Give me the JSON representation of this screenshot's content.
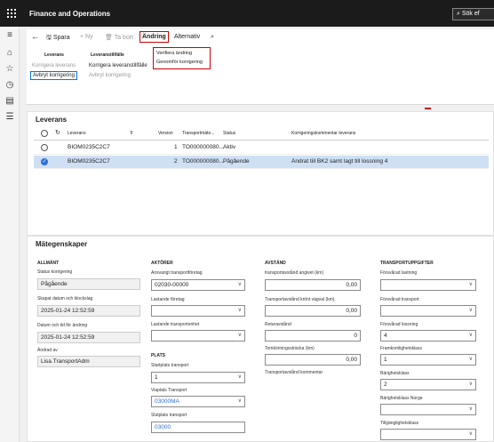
{
  "header": {
    "app_title": "Finance and Operations",
    "search_label": "Sök ef"
  },
  "toolbar": {
    "save": "Spara",
    "new": "Ny",
    "delete": "Ta bort",
    "tab_andring": "Ändring",
    "tab_alternativ": "Alternativ"
  },
  "groups": {
    "leverans": {
      "title": "Leverans",
      "btn1": "Korrigera leverans",
      "btn2": "Avbryt korrigering"
    },
    "leveranstillfalle": {
      "title": "Leveranstillfälle",
      "btn1": "Korrigera leveranstillfälle",
      "btn2": "Avbryt korrigering"
    },
    "andring_menu": [
      "Verifiera ändring",
      "Genomför korrigering"
    ]
  },
  "grid": {
    "title": "Leverans",
    "columns": [
      "Leverans",
      "Version",
      "Transportmäto...",
      "Status",
      "Korrigeringskommentar leverans"
    ],
    "rows": [
      {
        "leverans": "BIOM0235C2C7",
        "version": "1",
        "transport": "TO000000080...",
        "status": "Aktiv",
        "kommentar": ""
      },
      {
        "leverans": "BIOM0235C2C7",
        "version": "2",
        "transport": "TO000000080...",
        "status": "Pågående",
        "kommentar": "Ändrat till  BK2 samt lagt till lossning 4"
      }
    ]
  },
  "props": {
    "title": "Mätegenskaper",
    "allmant": {
      "head": "ALLMÄNT",
      "status_label": "Status korrigering",
      "status_value": "Pågående",
      "skapat_label": "Skapat datum och klockslag",
      "skapat_value": "2025-01-24 12:52:59",
      "datum_label": "Datum och tid för ändring",
      "datum_value": "2025-01-24 12:52:59",
      "andrat_label": "Ändrad av",
      "andrat_value": "Lisa.TransportAdm"
    },
    "aktorer": {
      "head": "AKTÖRER",
      "ansvarigt_label": "Ansvarigt transportföretag",
      "ansvarigt_value": "02030-00000",
      "lastande_label": "Lastande företag",
      "lastande_value": "",
      "lastenhet_label": "Lastande transportenhet",
      "lastenhet_value": ""
    },
    "plats": {
      "head": "PLATS",
      "start_label": "Startplats transport",
      "start_value": "1",
      "via_label": "Viaplats Transport",
      "via_value": "03000MA",
      "slut_label": "Slutplats transport",
      "slut_value": "03000"
    },
    "avstand": {
      "head": "AVSTÅND",
      "angivet_label": "transportavstånd angivet (km)",
      "angivet_value": "0,00",
      "kront_label": "Transportavstånd krönt vägval (km)",
      "kront_value": "0,00",
      "retur_label": "Returavstånd",
      "retur_value": "0",
      "tom_label": "Tomkörningssträcka (km)",
      "tom_value": "0,00",
      "kommentar_label": "Transportavstånd kommentar"
    },
    "uppgifter": {
      "head": "TRANSPORTUPPGIFTER",
      "forsv_last_label": "Försvårad lastning",
      "forsv_last_value": "",
      "forsv_trans_label": "Försvårad transport",
      "forsv_trans_value": "",
      "forsv_loss_label": "Försvårad lossning",
      "forsv_loss_value": "4",
      "framk_label": "Framkomlighetsklass",
      "framk_value": "1",
      "barig_label": "Bärighetsklass",
      "barig_value": "2",
      "barig_no_label": "Bärighetsklass Norge",
      "barig_no_value": "",
      "tillg_label": "Tillgänglighetsklass",
      "tillg_value": ""
    }
  },
  "colors": {
    "accent": "#2e6fd8",
    "highlight": "#cc0000",
    "topbar": "#1b1b1b"
  }
}
